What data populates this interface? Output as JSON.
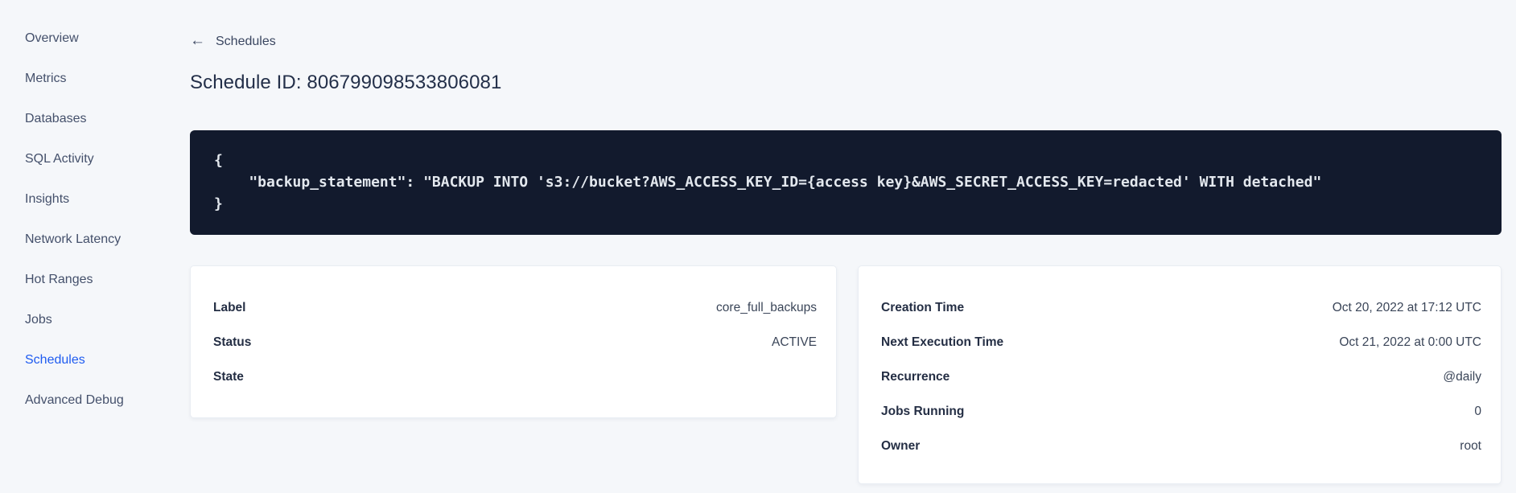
{
  "colors": {
    "page_bg": "#f5f7fa",
    "sidebar_text": "#44506b",
    "accent_blue": "#1e5bf0",
    "title_text": "#232f49",
    "code_bg": "#121a2d",
    "code_text": "#e3e8ee",
    "card_bg": "#ffffff",
    "card_border": "#e9edf3",
    "label_text": "#242e44",
    "value_text": "#3a4558"
  },
  "sidebar": {
    "items": [
      {
        "label": "Overview",
        "active": false
      },
      {
        "label": "Metrics",
        "active": false
      },
      {
        "label": "Databases",
        "active": false
      },
      {
        "label": "SQL Activity",
        "active": false
      },
      {
        "label": "Insights",
        "active": false
      },
      {
        "label": "Network Latency",
        "active": false
      },
      {
        "label": "Hot Ranges",
        "active": false
      },
      {
        "label": "Jobs",
        "active": false
      },
      {
        "label": "Schedules",
        "active": true
      },
      {
        "label": "Advanced Debug",
        "active": false
      }
    ]
  },
  "header": {
    "back_icon": "←",
    "back_label": "Schedules",
    "title": "Schedule ID: 806799098533806081"
  },
  "code_block": {
    "lines": [
      "{",
      "    \"backup_statement\": \"BACKUP INTO 's3://bucket?AWS_ACCESS_KEY_ID={access key}&AWS_SECRET_ACCESS_KEY=redacted' WITH detached\"",
      "}"
    ]
  },
  "details": {
    "left_card": {
      "rows": [
        {
          "label": "Label",
          "value": "core_full_backups"
        },
        {
          "label": "Status",
          "value": "ACTIVE"
        },
        {
          "label": "State",
          "value": ""
        }
      ]
    },
    "right_card": {
      "rows": [
        {
          "label": "Creation Time",
          "value": "Oct 20, 2022 at 17:12 UTC"
        },
        {
          "label": "Next Execution Time",
          "value": "Oct 21, 2022 at 0:00 UTC"
        },
        {
          "label": "Recurrence",
          "value": "@daily"
        },
        {
          "label": "Jobs Running",
          "value": "0"
        },
        {
          "label": "Owner",
          "value": "root"
        }
      ]
    }
  }
}
